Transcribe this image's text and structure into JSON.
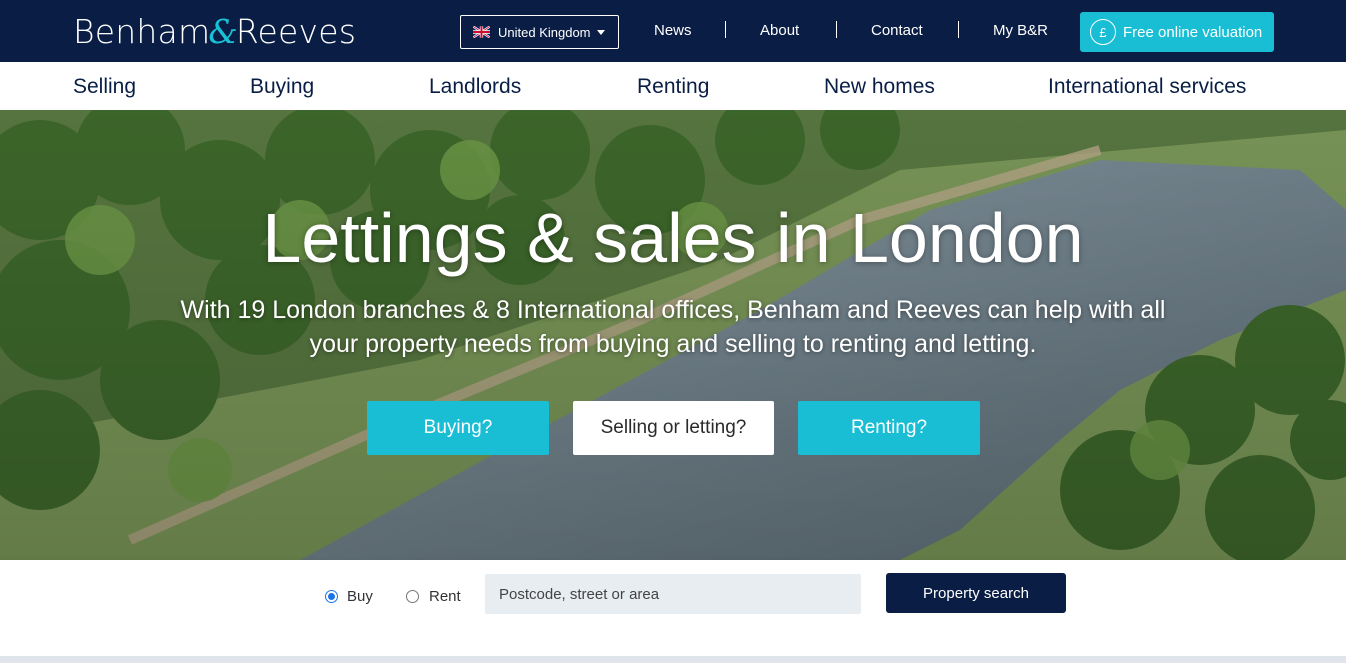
{
  "brand": {
    "logo_part1": "Benham",
    "logo_amp": "&",
    "logo_part2": "Reeves",
    "accent_color": "#19bdd4",
    "navy_color": "#0a1e45"
  },
  "topbar": {
    "country_label": "United Kingdom",
    "country_flag_icon": "uk-flag-icon",
    "links": [
      "News",
      "About",
      "Contact",
      "My B&R"
    ],
    "valuation_label": "Free online valuation",
    "valuation_icon": "pound-icon"
  },
  "nav": {
    "items": [
      "Selling",
      "Buying",
      "Landlords",
      "Renting",
      "New homes",
      "International services"
    ]
  },
  "hero": {
    "title": "Lettings & sales in London",
    "subtitle": "With 19 London branches & 8 International offices, Benham and Reeves can help with all your property needs from buying and selling to renting and letting.",
    "buttons": [
      "Buying?",
      "Selling or letting?",
      "Renting?"
    ]
  },
  "search": {
    "options": [
      "Buy",
      "Rent"
    ],
    "selected": "Buy",
    "placeholder": "Postcode, street or area",
    "button_label": "Property search"
  }
}
